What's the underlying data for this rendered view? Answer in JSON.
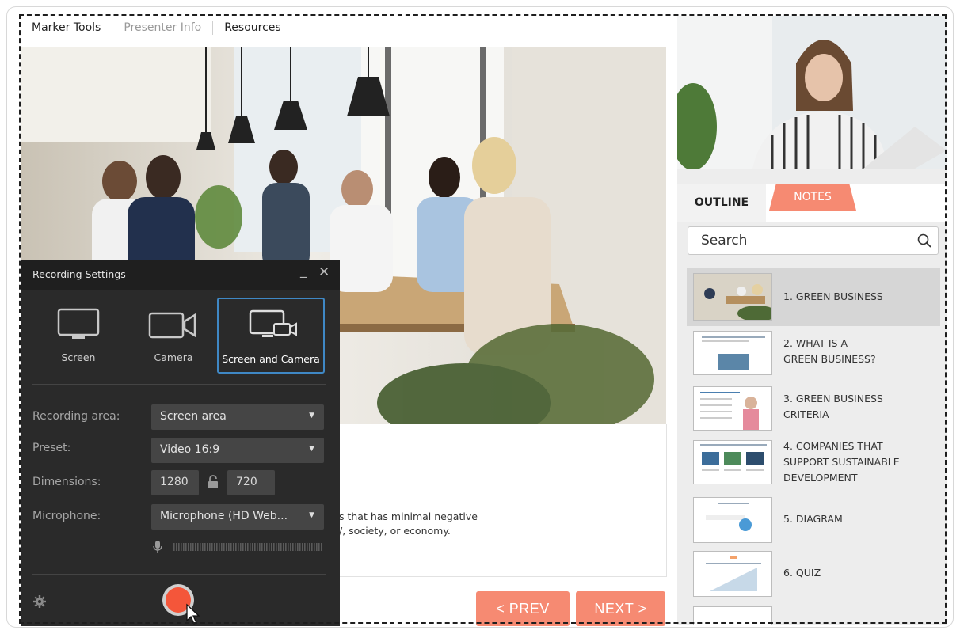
{
  "top_tabs": [
    "Marker Tools",
    "Presenter Info",
    "Resources"
  ],
  "slide": {
    "text_line1": "s that has minimal negative",
    "text_line2": "/, society, or economy."
  },
  "nav": {
    "prev": "< PREV",
    "next": "NEXT >"
  },
  "panel": {
    "tab_outline": "OUTLINE",
    "tab_notes": "NOTES",
    "search_placeholder": "Search",
    "outline": [
      {
        "label": "1. GREEN BUSINESS"
      },
      {
        "label": "2. WHAT IS A\nGREEN BUSINESS?"
      },
      {
        "label": "3. GREEN BUSINESS\nCRITERIA"
      },
      {
        "label": "4. COMPANIES THAT\nSUPPORT SUSTAINABLE\nDEVELOPMENT"
      },
      {
        "label": "5. DIAGRAM"
      },
      {
        "label": "6. QUIZ"
      }
    ]
  },
  "recording": {
    "title": "Recording Settings",
    "modes": [
      "Screen",
      "Camera",
      "Screen and Camera"
    ],
    "selected_mode": "Screen and Camera",
    "labels": {
      "area": "Recording area:",
      "preset": "Preset:",
      "dimensions": "Dimensions:",
      "microphone": "Microphone:"
    },
    "values": {
      "area": "Screen area",
      "preset": "Video 16:9",
      "width": "1280",
      "height": "720",
      "microphone": "Microphone (HD Web..."
    }
  },
  "colors": {
    "accent": "#f68a72",
    "record": "#f4563a",
    "selected": "#3f88c5"
  }
}
